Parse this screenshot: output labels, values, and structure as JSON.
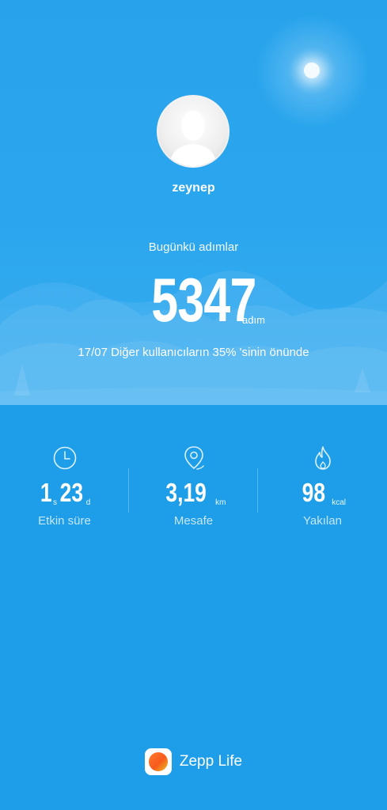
{
  "profile": {
    "username": "zeynep"
  },
  "steps": {
    "label": "Bugünkü adımlar",
    "value": "5347",
    "unit": "adım",
    "rank_text": "17/07 Diğer kullanıcıların 35% 'sinin önünde"
  },
  "stats": {
    "active_time": {
      "hours": "1",
      "hours_unit": "s",
      "minutes": "23",
      "minutes_unit": "d",
      "label": "Etkin süre",
      "icon": "clock-icon"
    },
    "distance": {
      "value": "3,19",
      "unit": "km",
      "label": "Mesafe",
      "icon": "location-pin-icon"
    },
    "calories": {
      "value": "98",
      "unit": "kcal",
      "label": "Yakılan",
      "icon": "flame-icon"
    }
  },
  "brand": {
    "name": "Zepp Life",
    "icon": "zepp-life-logo"
  },
  "colors": {
    "background": "#1e9ee9",
    "sky": "#2ba6ee",
    "text": "#ffffff",
    "logo_orange": "#f85a1e"
  }
}
